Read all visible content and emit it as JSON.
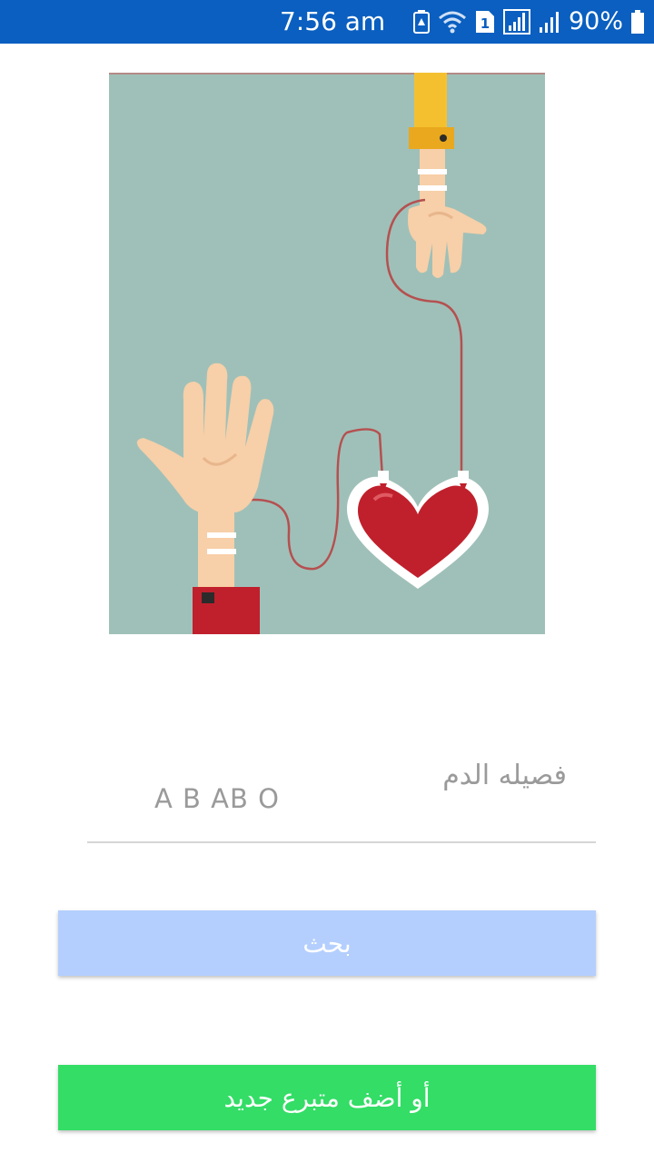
{
  "status_bar": {
    "time": "7:56 am",
    "battery": "90%",
    "sim_badge": "1",
    "background": "#0a5fc0",
    "icons": [
      "battery-saver-icon",
      "wifi-icon",
      "sim-icon",
      "signal-icon",
      "signal-icon",
      "battery-icon"
    ]
  },
  "illustration": {
    "description_icon": "blood-donation-illustration",
    "background": "#9fc0b8"
  },
  "blood_type_field": {
    "label": "فصيله الدم",
    "hint": "A B AB O"
  },
  "buttons": {
    "search_label": "بحث",
    "search_color": "#b4cffe",
    "add_donor_label": "أو أضف متبرع جديد",
    "add_donor_color": "#33dd66"
  }
}
